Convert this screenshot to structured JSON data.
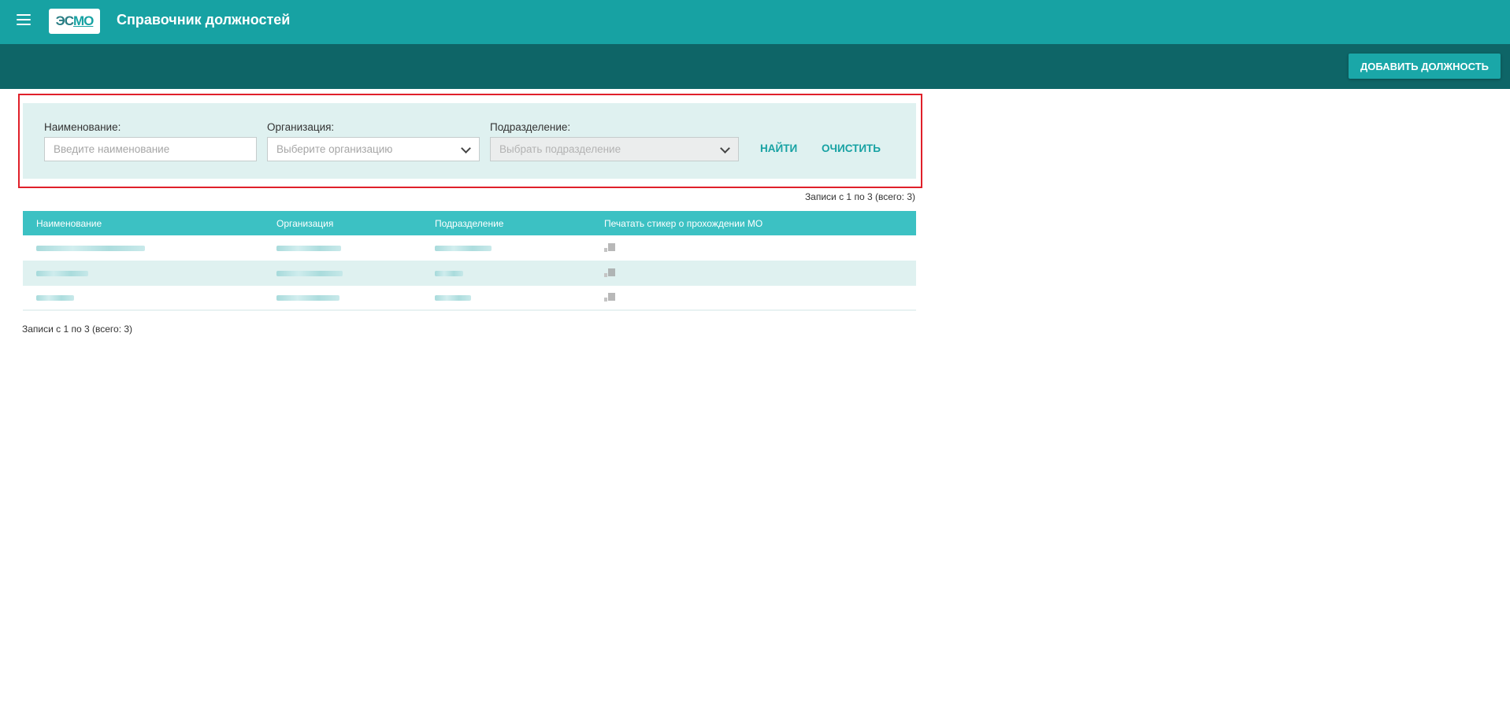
{
  "app": {
    "title": "Справочник должностей",
    "logo_main": "ЭС",
    "logo_accent": "МО"
  },
  "toolbar": {
    "add_label": "ДОБАВИТЬ ДОЛЖНОСТЬ"
  },
  "filters": {
    "name_label": "Наименование:",
    "name_placeholder": "Введите наименование",
    "name_value": "",
    "org_label": "Организация:",
    "org_placeholder": "Выберите организацию",
    "dept_label": "Подразделение:",
    "dept_placeholder": "Выбрать подразделение",
    "find_label": "НАЙТИ",
    "clear_label": "ОЧИСТИТЬ"
  },
  "records": {
    "top": "Записи с 1 по 3 (всего: 3)",
    "bottom": "Записи с 1 по 3 (всего: 3)"
  },
  "table": {
    "columns": [
      "Наименование",
      "Организация",
      "Подразделение",
      "Печатать стикер о прохождении МО"
    ]
  },
  "colors": {
    "appbar": "#17a2a3",
    "toolbar": "#0e6567",
    "table_header": "#3cc1c3",
    "panel": "#dff1f0",
    "highlight": "#e0202a"
  },
  "icons": [
    "menu-icon",
    "chevron-down-icon",
    "sticker-print-icon"
  ]
}
